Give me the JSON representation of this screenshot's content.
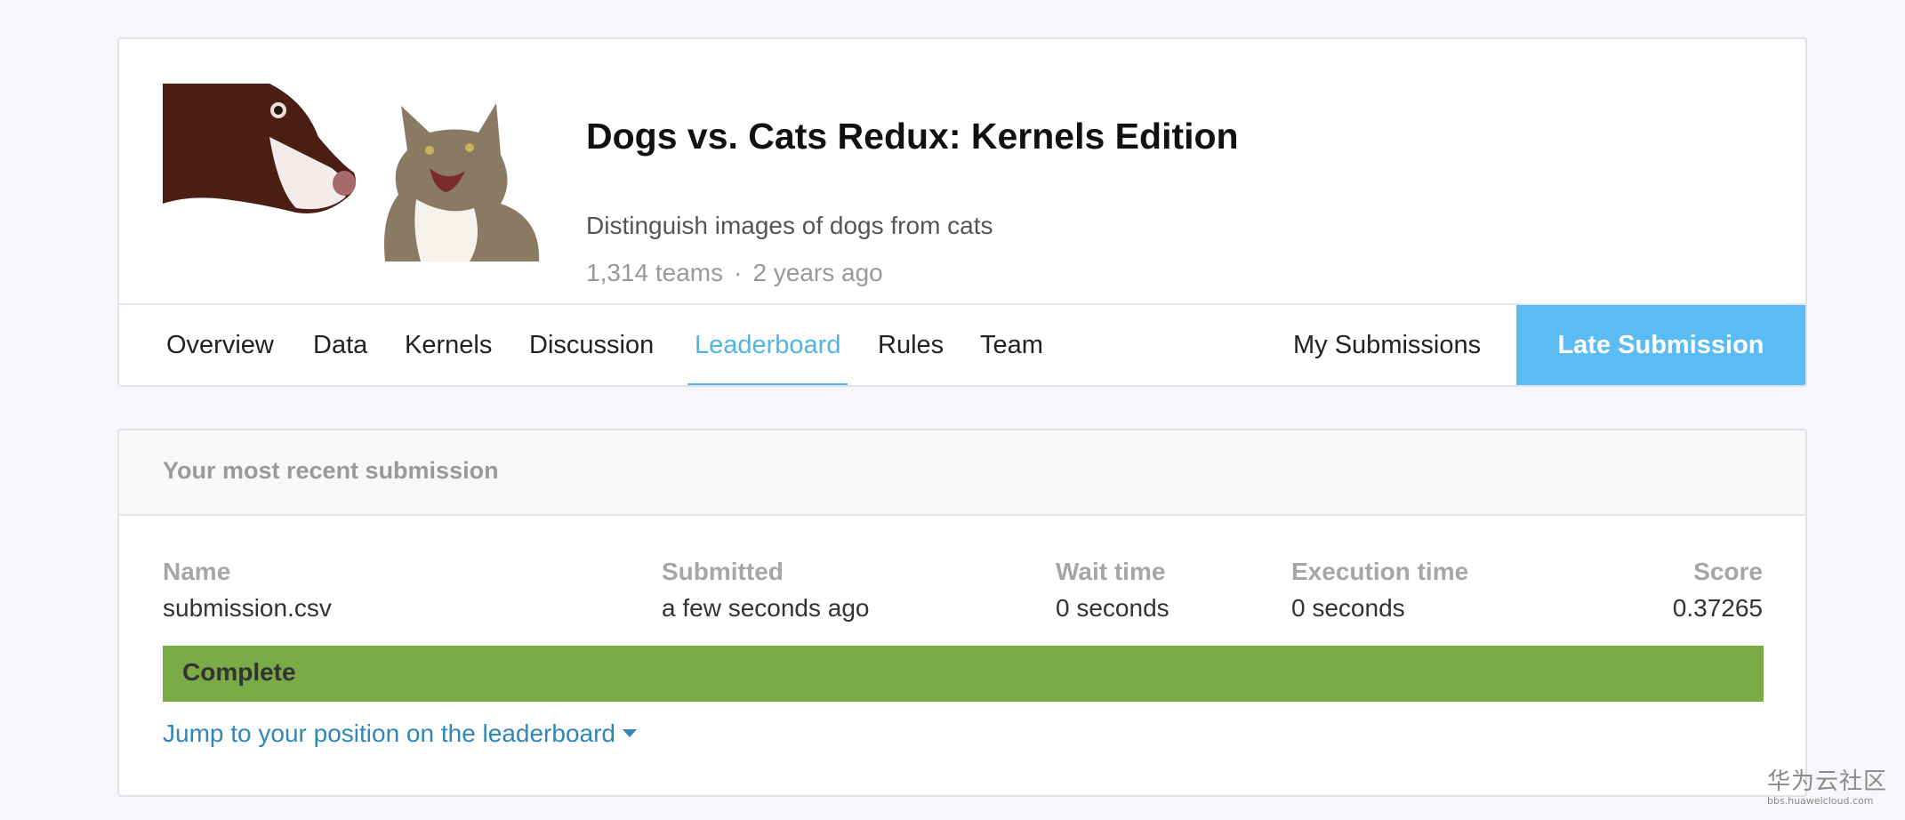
{
  "competition": {
    "title": "Dogs vs. Cats Redux: Kernels Edition",
    "description": "Distinguish images of dogs from cats",
    "teams": "1,314 teams",
    "separator": "·",
    "age": "2 years ago",
    "thumbnail_icon": "dog-and-cat-image"
  },
  "nav": {
    "tabs": [
      {
        "label": "Overview"
      },
      {
        "label": "Data"
      },
      {
        "label": "Kernels"
      },
      {
        "label": "Discussion"
      },
      {
        "label": "Leaderboard",
        "active": true
      },
      {
        "label": "Rules"
      },
      {
        "label": "Team"
      }
    ],
    "my_submissions": "My Submissions",
    "late_submission": "Late Submission",
    "accent_color": "#5bbcf4"
  },
  "submission": {
    "heading": "Your most recent submission",
    "columns": {
      "name": {
        "label": "Name",
        "value": "submission.csv"
      },
      "submitted": {
        "label": "Submitted",
        "value": "a few seconds ago"
      },
      "wait_time": {
        "label": "Wait time",
        "value": "0 seconds"
      },
      "execution_time": {
        "label": "Execution time",
        "value": "0 seconds"
      },
      "score": {
        "label": "Score",
        "value": "0.37265"
      }
    },
    "status": "Complete",
    "status_color": "#7bab47",
    "jump_link": "Jump to your position on the leaderboard"
  },
  "watermark": {
    "main": "华为云社区",
    "sub": "bbs.huaweicloud.com"
  }
}
